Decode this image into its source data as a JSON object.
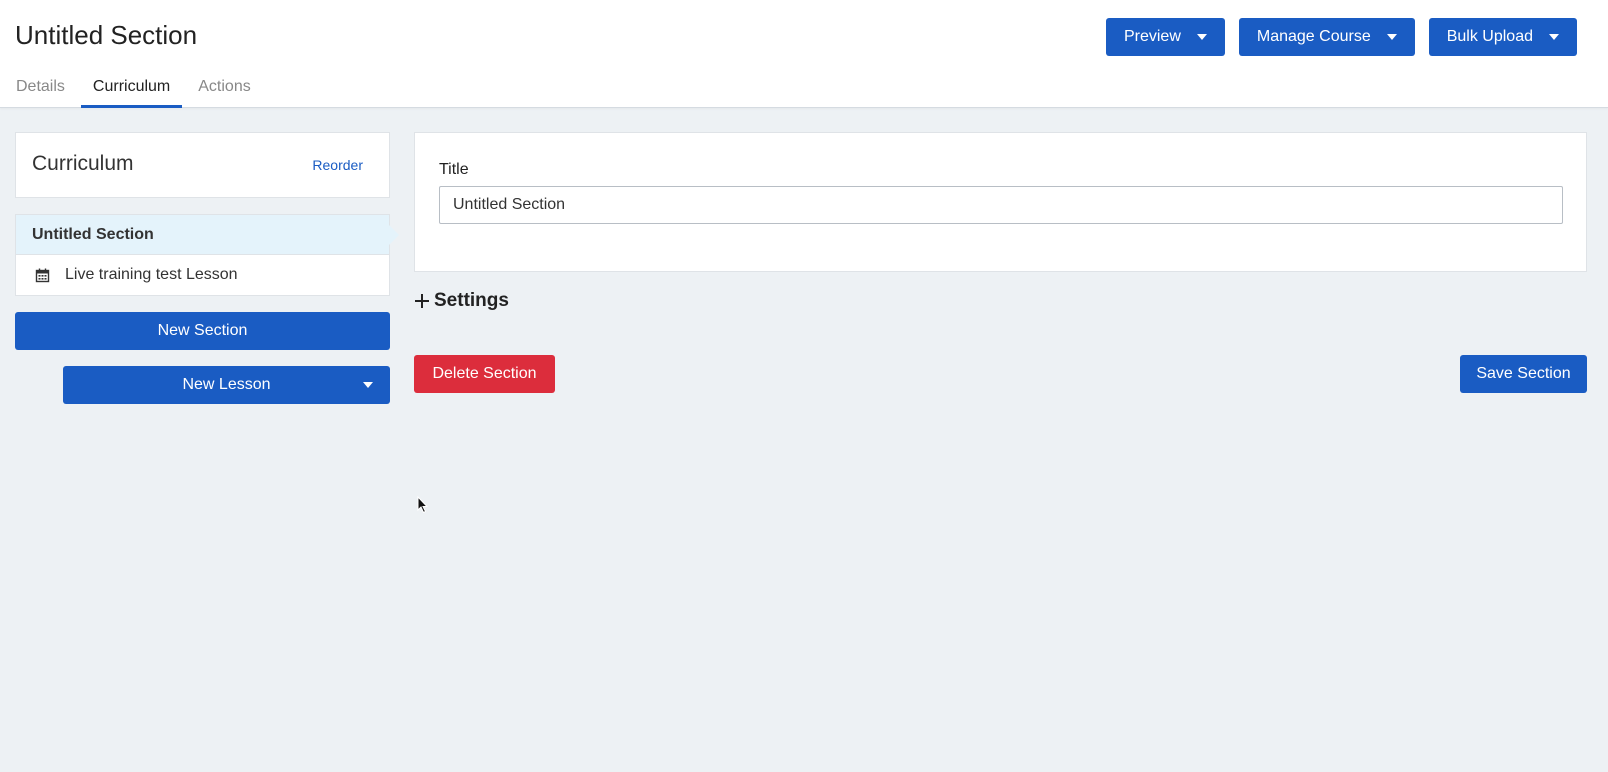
{
  "header": {
    "title": "Untitled Section",
    "actions": {
      "preview": "Preview",
      "manage_course": "Manage Course",
      "bulk_upload": "Bulk Upload"
    },
    "tabs": [
      {
        "label": "Details"
      },
      {
        "label": "Curriculum",
        "active": true
      },
      {
        "label": "Actions"
      }
    ]
  },
  "sidebar": {
    "title": "Curriculum",
    "reorder_label": "Reorder",
    "sections": [
      {
        "title": "Untitled Section",
        "lessons": [
          {
            "title": "Live training test Lesson",
            "icon": "calendar-icon"
          }
        ]
      }
    ],
    "new_section_label": "New Section",
    "new_lesson_label": "New Lesson"
  },
  "main": {
    "title_label": "Title",
    "title_value": "Untitled Section",
    "settings_label": "Settings",
    "delete_label": "Delete Section",
    "save_label": "Save Section"
  },
  "colors": {
    "primary": "#1a5cc3",
    "danger": "#dc2d3c",
    "selected_bg": "#e4f3fb",
    "page_bg": "#edf1f4"
  }
}
